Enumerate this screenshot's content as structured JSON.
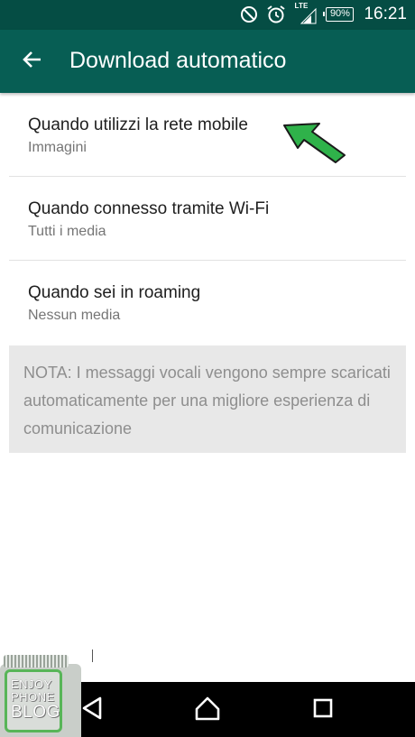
{
  "status_bar": {
    "icons": [
      "do-not-disturb-icon",
      "alarm-icon",
      "signal-icon",
      "battery-icon"
    ],
    "network_type": "LTE",
    "battery_level": "90%",
    "time": "16:21"
  },
  "toolbar": {
    "back_icon": "arrow-left-icon",
    "title": "Download automatico"
  },
  "settings": {
    "items": [
      {
        "title": "Quando utilizzi la rete mobile",
        "subtitle": "Immagini"
      },
      {
        "title": "Quando connesso tramite Wi-Fi",
        "subtitle": "Tutti i media"
      },
      {
        "title": "Quando sei in roaming",
        "subtitle": "Nessun media"
      }
    ]
  },
  "note": {
    "text": "NOTA: I messaggi vocali vengono sempre scaricati automaticamente per una migliore esperienza di comunicazione"
  },
  "nav_bar": {
    "icons": [
      "back-triangle-icon",
      "home-icon",
      "recents-icon"
    ]
  },
  "watermark": {
    "line1": "ENJOY",
    "line2": "PHONE",
    "line3": "BLOG"
  },
  "colors": {
    "status_bar": "#054d44",
    "toolbar": "#075e54",
    "pointer_arrow": "#2fb24a",
    "note_background": "#e8e8e8"
  }
}
